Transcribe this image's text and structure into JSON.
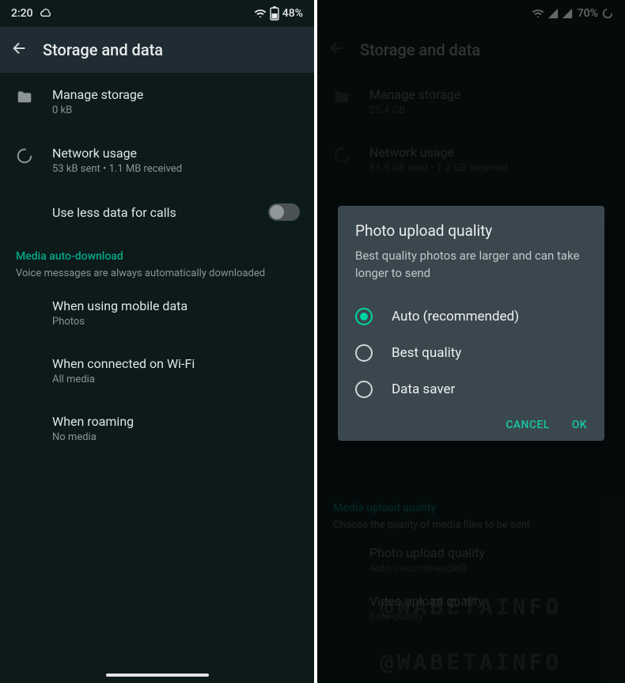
{
  "left": {
    "status": {
      "time": "2:20",
      "battery": "48%"
    },
    "appbar": {
      "title": "Storage and data"
    },
    "manage_storage": {
      "title": "Manage storage",
      "sub": "0 kB"
    },
    "network_usage": {
      "title": "Network usage",
      "sub": "53 kB sent • 1.1 MB received"
    },
    "less_data": {
      "title": "Use less data for calls"
    },
    "media_header": {
      "title": "Media auto-download",
      "sub": "Voice messages are always automatically downloaded"
    },
    "mobile": {
      "title": "When using mobile data",
      "sub": "Photos"
    },
    "wifi": {
      "title": "When connected on Wi-Fi",
      "sub": "All media"
    },
    "roaming": {
      "title": "When roaming",
      "sub": "No media"
    }
  },
  "right": {
    "status": {
      "battery": "70%"
    },
    "appbar": {
      "title": "Storage and data"
    },
    "manage_storage": {
      "title": "Manage storage",
      "sub": "25.4 GB"
    },
    "network_usage": {
      "title": "Network usage",
      "sub": "81.5 GB sent • 1.2 GB received"
    },
    "upload_header": {
      "title": "Media upload quality",
      "sub": "Choose the quality of media files to be sent"
    },
    "photo_quality": {
      "title": "Photo upload quality",
      "sub": "Auto (recommended)"
    },
    "video_quality": {
      "title": "Video upload quality",
      "sub": "Best quality"
    },
    "dialog": {
      "title": "Photo upload quality",
      "sub": "Best quality photos are larger and can take longer to send",
      "opt1": "Auto (recommended)",
      "opt2": "Best quality",
      "opt3": "Data saver",
      "cancel": "CANCEL",
      "ok": "OK"
    },
    "watermark": "@WABETAINFO"
  }
}
